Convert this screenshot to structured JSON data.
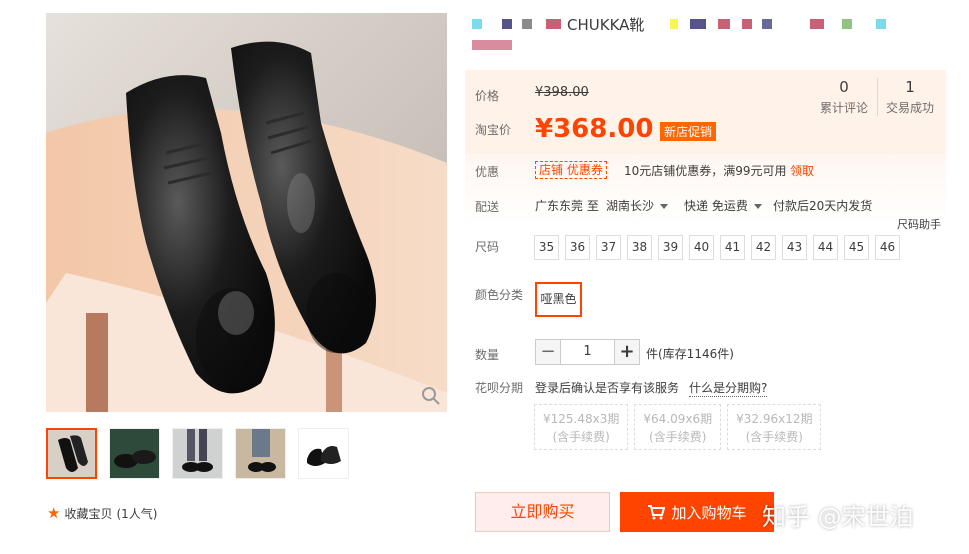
{
  "product": {
    "title_visible": "CHUKKA靴",
    "title_blur_colors": [
      "#22c3e0",
      "#2a2a6e",
      "#b01c3c",
      "#5a5a5a",
      "#f2f20a",
      "#4a9a2a"
    ]
  },
  "price": {
    "label": "价格",
    "original": "¥398.00",
    "promo_label": "淘宝价",
    "current": "¥368.00",
    "badge": "新店促销"
  },
  "stats": [
    {
      "num": "0",
      "label": "累计评论"
    },
    {
      "num": "1",
      "label": "交易成功"
    }
  ],
  "coupon": {
    "label": "优惠",
    "tag": "店铺 优惠券",
    "desc": "10元店铺优惠券，满99元可用",
    "action": "领取"
  },
  "shipping": {
    "label": "配送",
    "from": "广东东莞 至",
    "to": "湖南长沙",
    "method": "快递 免运费",
    "delivery": "付款后20天内发货"
  },
  "size": {
    "label": "尺码",
    "helper": "尺码助手",
    "options": [
      "35",
      "36",
      "37",
      "38",
      "39",
      "40",
      "41",
      "42",
      "43",
      "44",
      "45",
      "46"
    ]
  },
  "color": {
    "label": "颜色分类",
    "selected": "哑黑色"
  },
  "quantity": {
    "label": "数量",
    "minus": "−",
    "value": "1",
    "plus": "+",
    "stock": "件(库存1146件)"
  },
  "huabei": {
    "label": "花呗分期",
    "text": "登录后确认是否享有该服务",
    "link": "什么是分期购?",
    "plans": [
      {
        "amount": "¥125.48x3期",
        "note": "(含手续费)"
      },
      {
        "amount": "¥64.09x6期",
        "note": "(含手续费)"
      },
      {
        "amount": "¥32.96x12期",
        "note": "(含手续费)"
      }
    ]
  },
  "actions": {
    "buy": "立即购买",
    "cart": "加入购物车"
  },
  "favorite": {
    "label": "收藏宝贝",
    "count": "(1人气)"
  },
  "watermark": "知乎 @宋世泊",
  "colors": {
    "accent": "#ff4400",
    "price_bg": "#fff2e8"
  }
}
